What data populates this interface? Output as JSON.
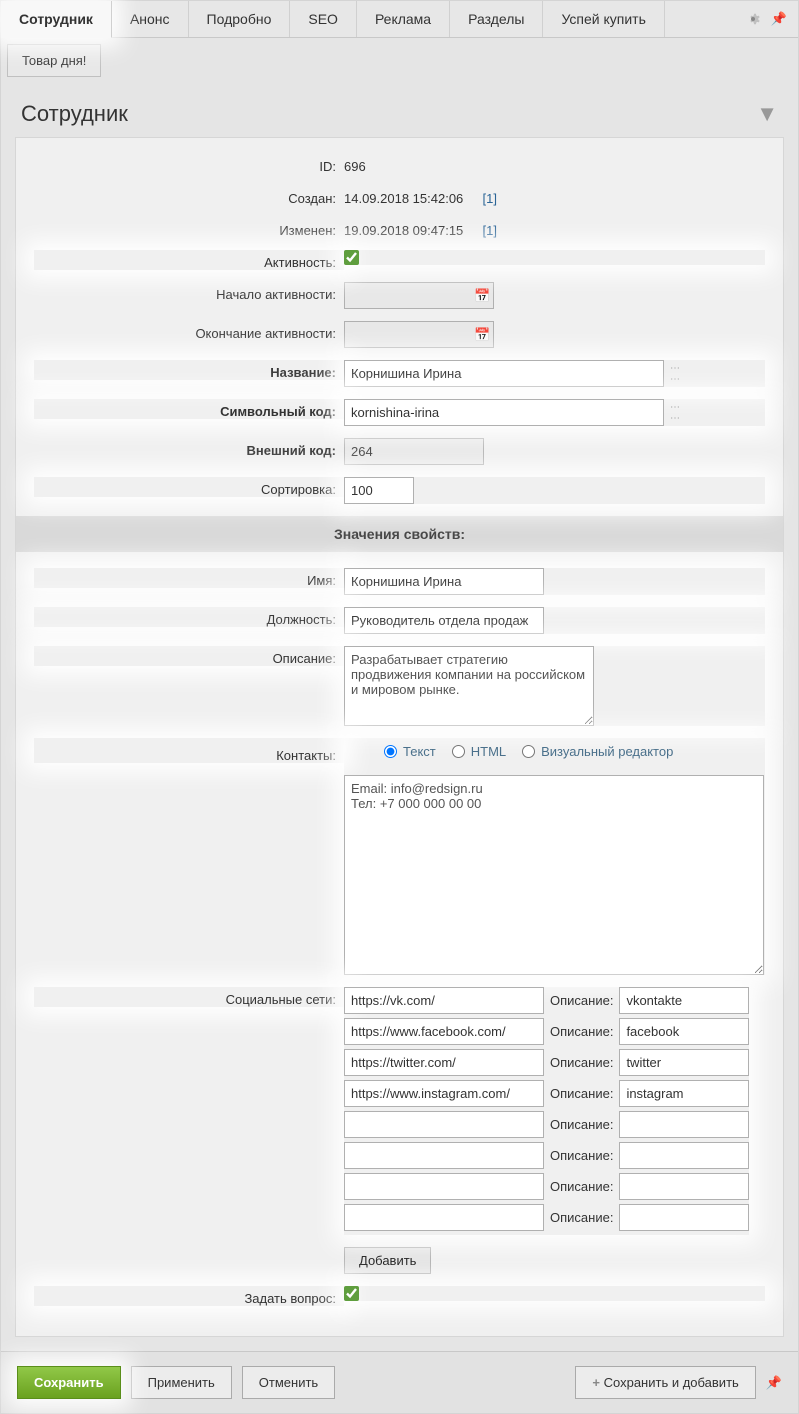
{
  "tabs": [
    "Сотрудник",
    "Анонс",
    "Подробно",
    "SEO",
    "Реклама",
    "Разделы",
    "Успей купить"
  ],
  "subtab": "Товар дня!",
  "section_title": "Сотрудник",
  "fields": {
    "id_label": "ID:",
    "id_value": "696",
    "created_label": "Создан:",
    "created_value": "14.09.2018 15:42:06",
    "created_link": "[1]",
    "changed_label": "Изменен:",
    "changed_value": "19.09.2018 09:47:15",
    "changed_link": "[1]",
    "active_label": "Активность:",
    "start_label": "Начало активности:",
    "end_label": "Окончание активности:",
    "name_label": "Название:",
    "name_value": "Корнишина Ирина",
    "code_label": "Символьный код:",
    "code_value": "kornishina-irina",
    "ext_label": "Внешний код:",
    "ext_value": "264",
    "sort_label": "Сортировка:",
    "sort_value": "100"
  },
  "props_header": "Значения свойств:",
  "props": {
    "name_label": "Имя:",
    "name_value": "Корнишина Ирина",
    "pos_label": "Должность:",
    "pos_value": "Руководитель отдела продаж",
    "desc_label": "Описание:",
    "desc_value": "Разрабатывает стратегию продвижения компании на российском и мировом рынке.",
    "contacts_label": "Контакты:",
    "contacts_value": "Email: info@redsign.ru\nТел: +7 000 000 00 00",
    "radio_text": "Текст",
    "radio_html": "HTML",
    "radio_visual": "Визуальный редактор",
    "social_label": "Социальные сети:",
    "social_desc_label": "Описание:",
    "social": [
      {
        "url": "https://vk.com/",
        "desc": "vkontakte"
      },
      {
        "url": "https://www.facebook.com/",
        "desc": "facebook"
      },
      {
        "url": "https://twitter.com/",
        "desc": "twitter"
      },
      {
        "url": "https://www.instagram.com/",
        "desc": "instagram"
      },
      {
        "url": "",
        "desc": ""
      },
      {
        "url": "",
        "desc": ""
      },
      {
        "url": "",
        "desc": ""
      },
      {
        "url": "",
        "desc": ""
      }
    ],
    "add_label": "Добавить",
    "ask_label": "Задать вопрос:"
  },
  "footer": {
    "save": "Сохранить",
    "apply": "Применить",
    "cancel": "Отменить",
    "save_add": "Сохранить и добавить"
  }
}
